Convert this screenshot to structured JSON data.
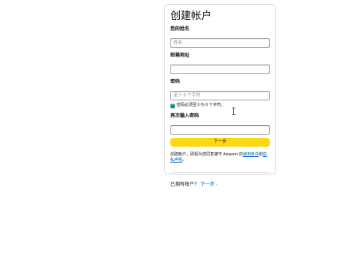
{
  "form": {
    "title": "创建帐户",
    "name_label": "您的姓名",
    "name_placeholder": "姓名",
    "email_label": "邮箱地址",
    "email_value": "",
    "password_label": "密码",
    "password_placeholder": "至少 6 个字符",
    "password_hint": "密码必须至少为 6 个字符。",
    "confirm_label": "再次输入密码",
    "confirm_value": "",
    "next_button": "下一步",
    "legal_prefix": "创建帐户，即视为您同意遵守 Amazon 的",
    "legal_link1": "使用条件",
    "legal_mid": "和",
    "legal_link2": "隐私声明",
    "legal_suffix": "。",
    "signin_prefix": "已拥有帐户？",
    "signin_link": "下一步"
  },
  "icons": {
    "info": "info-icon",
    "caret": "caret-right-icon",
    "cursor": "text-cursor-icon"
  },
  "colors": {
    "button_bg": "#ffd814",
    "link": "#0066c0",
    "info": "#0b7580"
  }
}
